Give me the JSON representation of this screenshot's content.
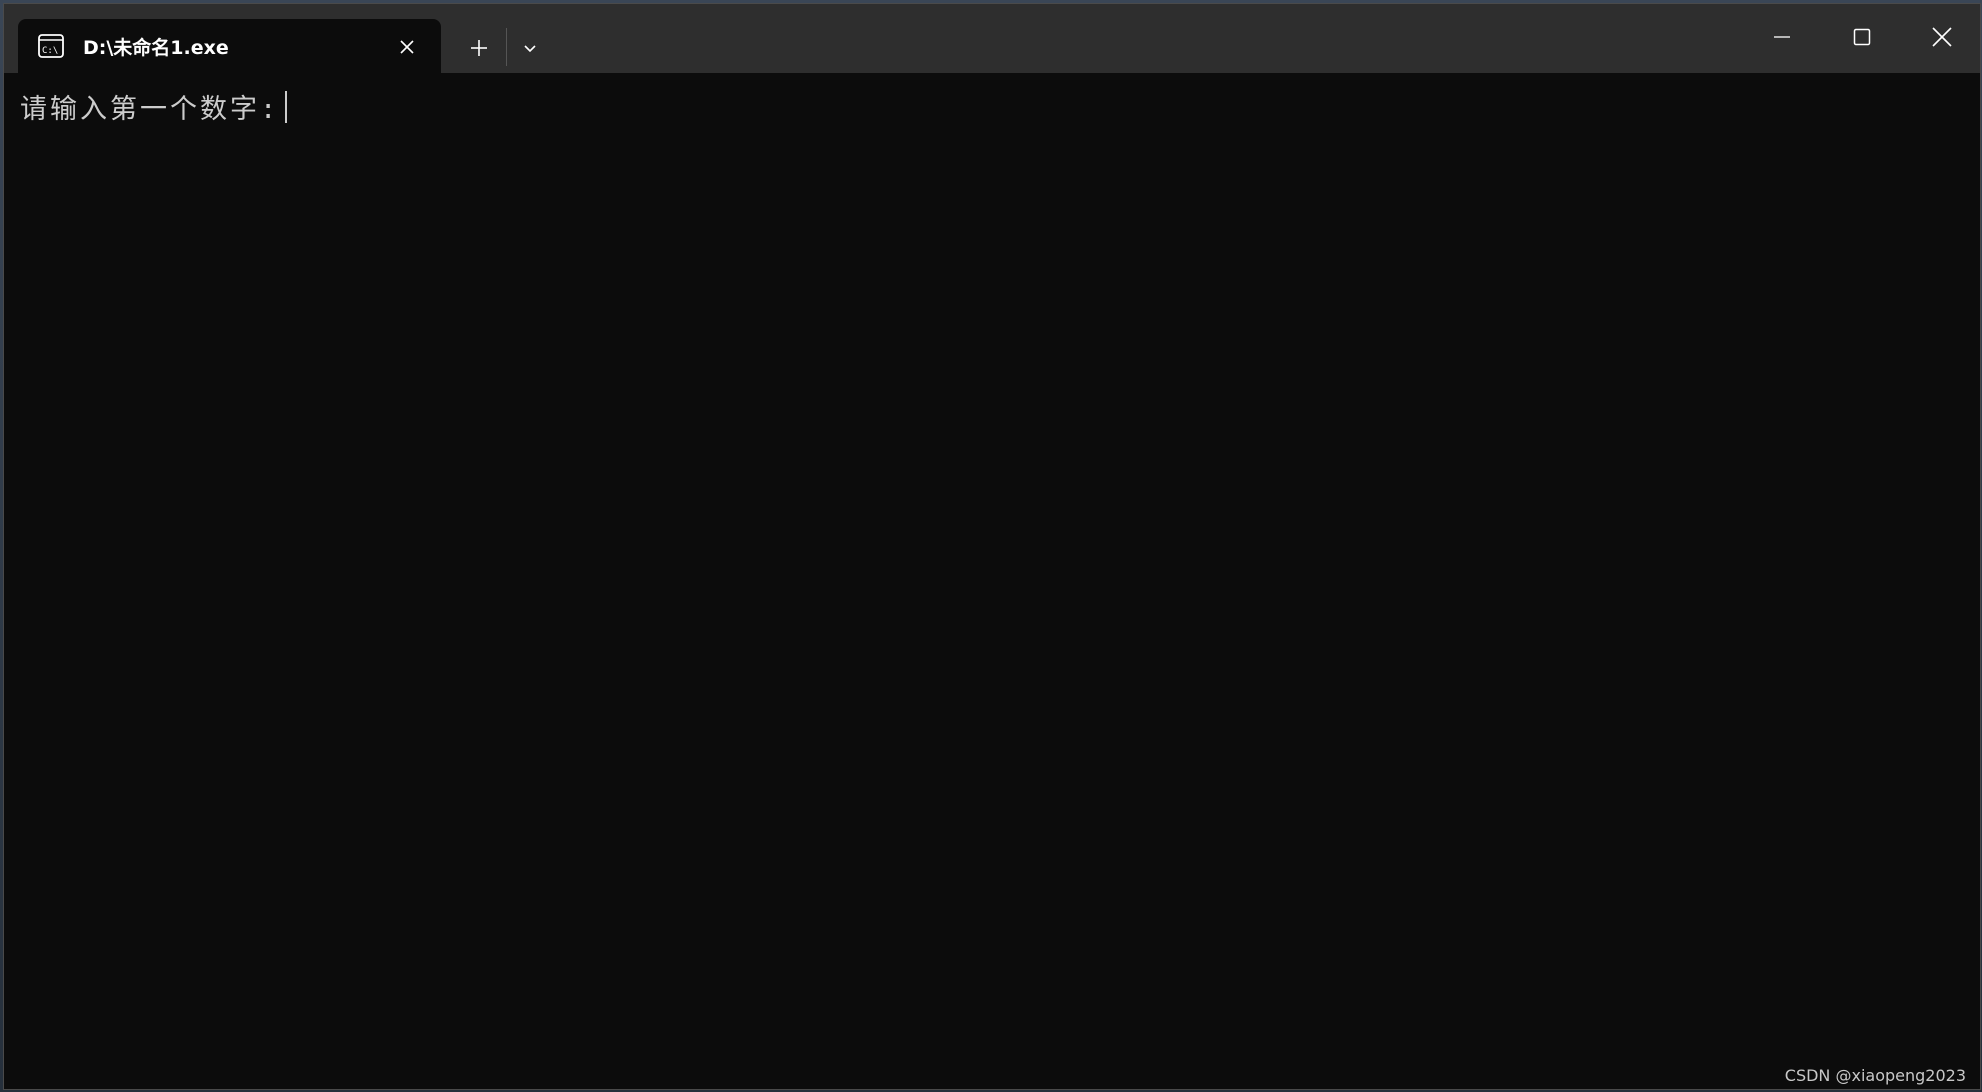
{
  "window": {
    "tab_title": "D:\\未命名1.exe",
    "tab_icon": "console-icon",
    "buttons": {
      "close_tab": "close-icon",
      "new_tab": "plus-icon",
      "dropdown": "chevron-down-icon",
      "minimize": "minimize-icon",
      "maximize": "maximize-icon",
      "close_window": "close-icon"
    }
  },
  "console": {
    "prompt": "请输入第一个数字:"
  },
  "watermark": "CSDN @xiaopeng2023",
  "colors": {
    "titlebar": "#2e2e2e",
    "console_bg": "#0c0c0c",
    "console_text": "#cccccc"
  }
}
